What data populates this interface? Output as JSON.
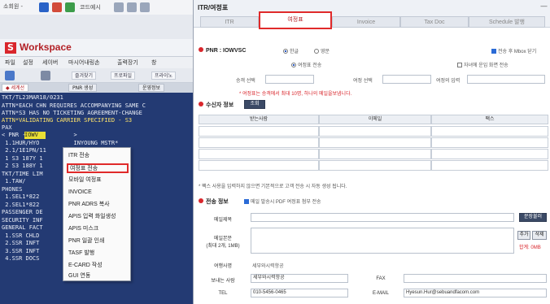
{
  "topstrip": {
    "left_label": "소회원 -",
    "right_label": "코드예시"
  },
  "workspace": {
    "title": "Workspace",
    "menu": [
      "파일",
      "설정",
      "세이버",
      "마시어내링손",
      "출력장기",
      "창"
    ],
    "toolbar": [
      "즐겨찾기",
      "프로파일",
      "프라이노"
    ],
    "tabs": [
      "◆ 세계선",
      "PNR 생성",
      "운영정보"
    ],
    "terminal_lines": [
      "TKT/TL23MAR18/0231",
      "ATTN*EACH CHN REQUIRES ACCOMPANYING SAME C",
      "ATTN*S3 HAS NO TICKETING AGREEMENT-CHANGE",
      "ATTN*VALIDATING CARRIER SPECIFIED - S3",
      "PAX",
      "< PNR -              >",
      " 1.1HUR/HYO          INYOUNG MSTR*",
      " 2.1/1E1PN/11",
      " 1 S3 187Y 1         8235  0605",
      " 2 S3 188Y 1         1718  2240",
      "TKT/TIME LIM",
      " 1.TAW/",
      "PHONES",
      " 1.SEL1*822          EL MR KIN/KIS",
      " 2.SEL1*822          KANG/YOONHO",
      "PASSENGER DE         - USE PD TO",
      "SECURITY INF         *PAD TO DISPL",
      "GENERAL FACT",
      " 1.SSR CHLD          Y15MAY/KIM/J",
      " 2.SSR INFT          Y17MAY/KIM/J",
      " 3.SSR INFT          Y15MAY/KIM/J",
      " 4.SSR DOCS          F5 KOR"
    ],
    "pnr_highlight": "IOWV"
  },
  "context_menu": {
    "items": [
      "ITR 전송",
      "여정표 전송",
      "모바일 여정표",
      "INVOICE",
      "PNR ADRS 복사",
      "APIS 입력 화일생성",
      "APIS 미스크",
      "PNR 일괄 인쇄",
      "TASF 발행",
      "E-CARD 작성",
      "GUI 연동"
    ],
    "selected_index": 1
  },
  "dialog": {
    "title": "ITR/여정표",
    "close": "—",
    "tabs": [
      "ITR",
      "여정표",
      "Invoice",
      "Tax Doc",
      "Schedule 발행"
    ],
    "active_tab": 1,
    "pnr_label": "PNR : IOWVSC",
    "lang_korean": "한글",
    "lang_english": "영문",
    "send_mobile": "전송 후 Mbox 닫기",
    "itinerary_send": "여정표 전송",
    "attach_receipt": "자녀에 운임 화면 전송",
    "field_labels": [
      "승객 선택",
      "여정 선택",
      "여정의 입력"
    ],
    "notice": "* 여정표는 승객에서 최대 10명, 하나의 메일을보냅니다.",
    "recipient_section": "수신자 정보",
    "recipient_btn": "조회",
    "table_headers": [
      "받는사람",
      "이메일",
      "팩스"
    ],
    "bottom_notice": "* 팩스 사용을 입력하지 않으면 기본적으로 고객 전송 시 자동 생성 됩니다.",
    "send_section": "전송 정보",
    "send_option": "메일 발송시 PDF 여정표 첨부 전송",
    "mail_subject_label": "메일제목",
    "mail_body_label": "메일본문",
    "mail_body_sub": "(최대 2개, 1MB)",
    "btn_template": "문장불러",
    "btn_add": "추가",
    "btn_delete": "삭제",
    "size_note": "합계: 0MB",
    "sender_label": "여행사명",
    "sender_value": "세부와시력항공",
    "from_label": "보내는 사람",
    "from_value": "세부와시력항공",
    "fax_label": "FAX",
    "tel_label": "TEL",
    "tel_value": "010-5456-0465",
    "email_label": "E-MAIL",
    "email_value": "Hyesun.Hur@sebuandfacom.com"
  }
}
